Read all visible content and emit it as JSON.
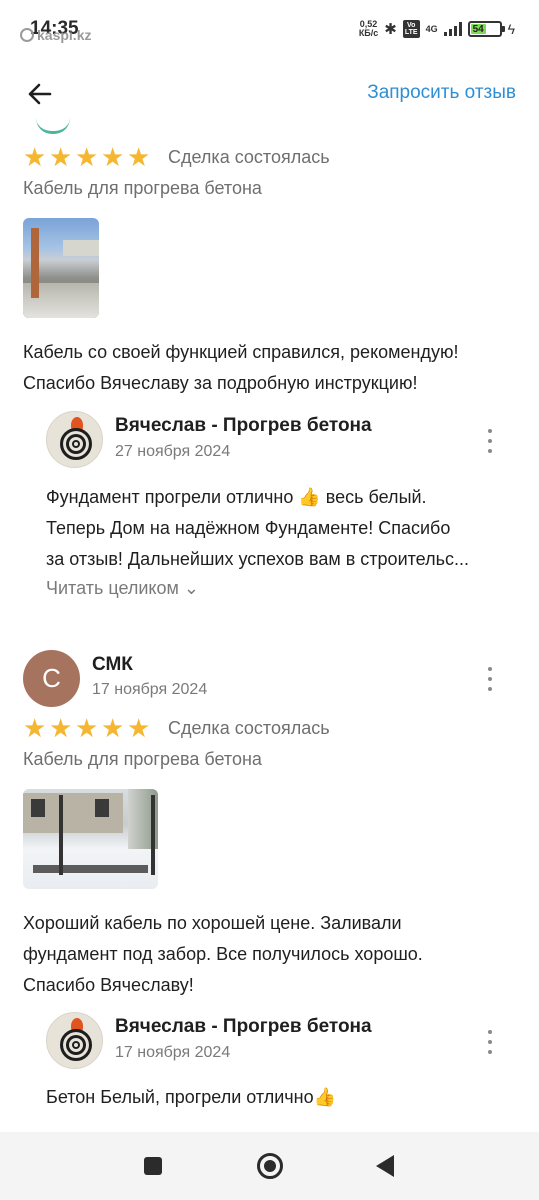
{
  "status_bar": {
    "time": "14:35",
    "watermark": "kaspi.kz",
    "speed_value": "0,52",
    "speed_unit": "КБ/с",
    "network": "4G",
    "battery": "54",
    "icons": [
      "bluetooth-icon",
      "volte-icon",
      "signal-icon",
      "battery-icon",
      "charging-icon"
    ]
  },
  "header": {
    "back_icon": "arrow-left-icon",
    "request_review": "Запросить отзыв"
  },
  "reviews": [
    {
      "rating": 5,
      "deal_status": "Сделка состоялась",
      "product": "Кабель для прогрева бетона",
      "text_line1": "Кабель со своей функцией справился, рекомендую!",
      "text_line2": "Спасибо Вячеславу за подробную инструкцию!",
      "reply": {
        "name": "Вячеслав - Прогрев бетона",
        "date": "27 ноября 2024",
        "text_line1": "Фундамент прогрели отлично 👍  весь белый.",
        "text_line2": "Теперь Дом на надёжном Фундаменте! Спасибо",
        "text_line3": "за отзыв! Дальнейших успехов вам в строительс...",
        "read_more": "Читать целиком"
      }
    },
    {
      "author_initial": "С",
      "author": "СМК",
      "date": "17 ноября 2024",
      "rating": 5,
      "deal_status": "Сделка состоялась",
      "product": "Кабель для прогрева бетона",
      "text_line1": "Хороший кабель по хорошей цене. Заливали",
      "text_line2": "фундамент под забор. Все получилось хорошо.",
      "text_line3": "Спасибо Вячеславу!",
      "reply": {
        "name": "Вячеслав - Прогрев бетона",
        "date": "17 ноября 2024",
        "text_line1": "Бетон Белый, прогрели отлично👍"
      }
    }
  ],
  "star_glyph": "★",
  "chevron_glyph": "⌄",
  "colors": {
    "accent": "#2e8fd6",
    "star": "#f5b731",
    "avatar": "#a6735f"
  }
}
